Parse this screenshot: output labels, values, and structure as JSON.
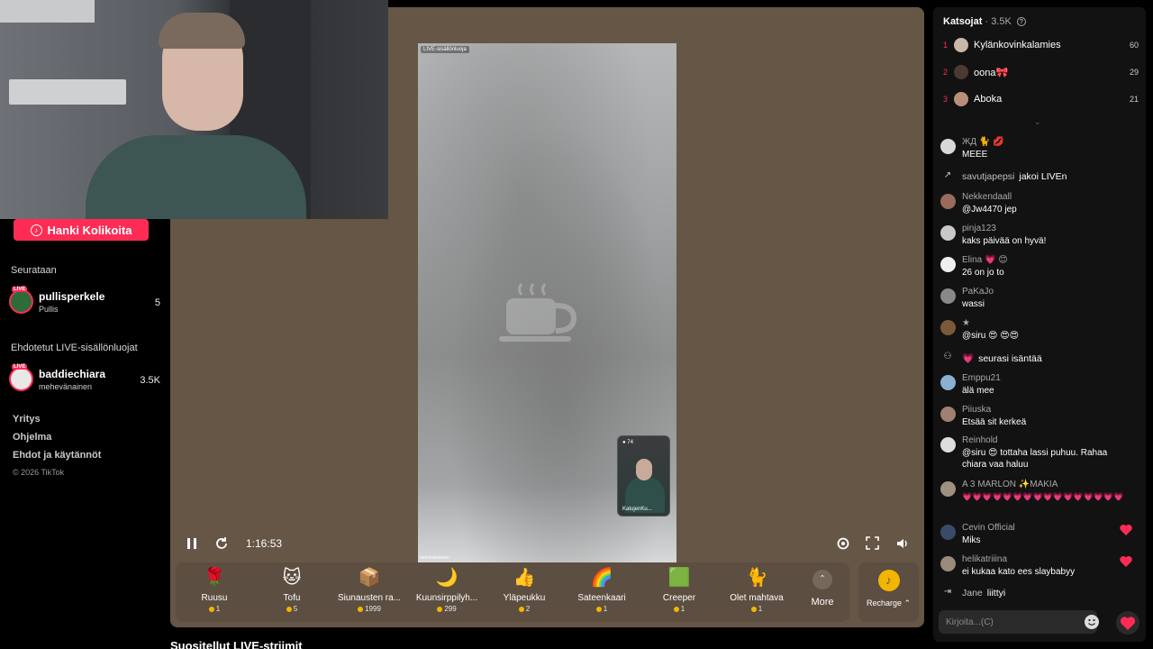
{
  "sidebar": {
    "coins_button": "Hanki Kolikoita",
    "following_header": "Seurataan",
    "following": [
      {
        "name": "pullisperkele",
        "sub": "Pullis",
        "count": "5",
        "badge": "LIVE"
      }
    ],
    "suggested_header": "Ehdotetut LIVE-sisällönluojat",
    "suggested": [
      {
        "name": "baddiechiara",
        "sub": "mehevänainen",
        "count": "3.5K",
        "badge": "LIVE"
      }
    ],
    "footer_links": [
      "Yritys",
      "Ohjelma",
      "Ehdot ja käytännöt"
    ],
    "copyright": "© 2026 TikTok"
  },
  "player": {
    "video_tag_top": "LIVE-sisällönluoja",
    "video_tag_bottom": "mehevänainen",
    "pip_viewers": "74",
    "pip_name": "KatujenKu...",
    "elapsed": "1:16:53"
  },
  "gifts": [
    {
      "name": "Ruusu",
      "price": "1",
      "icon": "rose-icon",
      "glyph": "🌹"
    },
    {
      "name": "Tofu",
      "price": "5",
      "icon": "tofu-icon",
      "glyph": "🐱"
    },
    {
      "name": "Siunausten ra...",
      "price": "1999",
      "icon": "treasure-icon",
      "glyph": "📦"
    },
    {
      "name": "Kuunsirppilyh...",
      "price": "299",
      "icon": "moon-icon",
      "glyph": "🌙"
    },
    {
      "name": "Yläpeukku",
      "price": "2",
      "icon": "thumbs-up-icon",
      "glyph": "👍"
    },
    {
      "name": "Sateenkaari",
      "price": "1",
      "icon": "rainbow-icon",
      "glyph": "🌈"
    },
    {
      "name": "Creeper",
      "price": "1",
      "icon": "creeper-icon",
      "glyph": "🟩"
    },
    {
      "name": "Olet mahtava",
      "price": "1",
      "icon": "cat-icon",
      "glyph": "🐈"
    }
  ],
  "more_label": "More",
  "recharge_label": "Recharge",
  "recommended_title": "Suositellut LIVE-striimit",
  "chat": {
    "viewers_label": "Katsojat",
    "viewers_count": "· 3.5K",
    "top_viewers": [
      {
        "rank": "1",
        "name": "Kylänkovinkalamies",
        "score": "60",
        "color": "#c9b8a8"
      },
      {
        "rank": "2",
        "name": "oona🎀",
        "score": "29",
        "color": "#4a3a30"
      },
      {
        "rank": "3",
        "name": "Aboka",
        "score": "21",
        "color": "#b89078"
      }
    ],
    "messages": [
      {
        "type": "msg",
        "user": "ЖД 🐈 💋",
        "text": "MEEE",
        "color": "#d8d8d8"
      },
      {
        "type": "sys",
        "user": "savutjapepsi",
        "action": "jakoi LIVEn",
        "icon": "share-icon"
      },
      {
        "type": "msg",
        "user": "Nekkendaall",
        "text": "@Jw4470 jep",
        "color": "#9a6a5a"
      },
      {
        "type": "msg",
        "user": "pinja123",
        "text": "kaks päivää on hyvä!",
        "color": "#c8c8c8"
      },
      {
        "type": "msg",
        "user": "Elina 💗 😊",
        "text": "26 on jo to",
        "color": "#eee"
      },
      {
        "type": "msg",
        "user": "PaKaJo",
        "text": "wassi",
        "color": "#888"
      },
      {
        "type": "msg",
        "user": "★",
        "text": "@siru 😍 😍😍",
        "color": "#7a5a3a"
      },
      {
        "type": "sys",
        "user": "💗",
        "action": "seurasi isäntää",
        "icon": "follow-icon"
      },
      {
        "type": "msg",
        "user": "Emppu21",
        "text": "älä mee",
        "color": "#8ab0d0"
      },
      {
        "type": "msg",
        "user": "Piiuska",
        "text": "Etsää sit kerkeä",
        "color": "#a08070"
      },
      {
        "type": "msg",
        "user": "Reinhold",
        "text": "@siru 😍 tottaha lassi puhuu. Rahaa chiara vaa haluu",
        "color": "#ddd"
      },
      {
        "type": "msg",
        "user": "A 3  MARLON ✨MAKIA",
        "text": "💗💗💗💗💗💗💗💗💗💗💗💗💗💗💗💗",
        "color": "#a09080"
      },
      {
        "type": "msg",
        "user": "Cevin Official",
        "text": "Miks",
        "color": "#3a4a6a",
        "heart": true
      },
      {
        "type": "msg",
        "user": "helikatriiina",
        "text": "ei kukaa kato ees slaybabyy",
        "color": "#9a8a7a",
        "heart": true
      },
      {
        "type": "sys",
        "user": "Jane",
        "action": "liittyi",
        "icon": "join-icon"
      }
    ],
    "input_placeholder": "Kirjoita...(C)"
  }
}
